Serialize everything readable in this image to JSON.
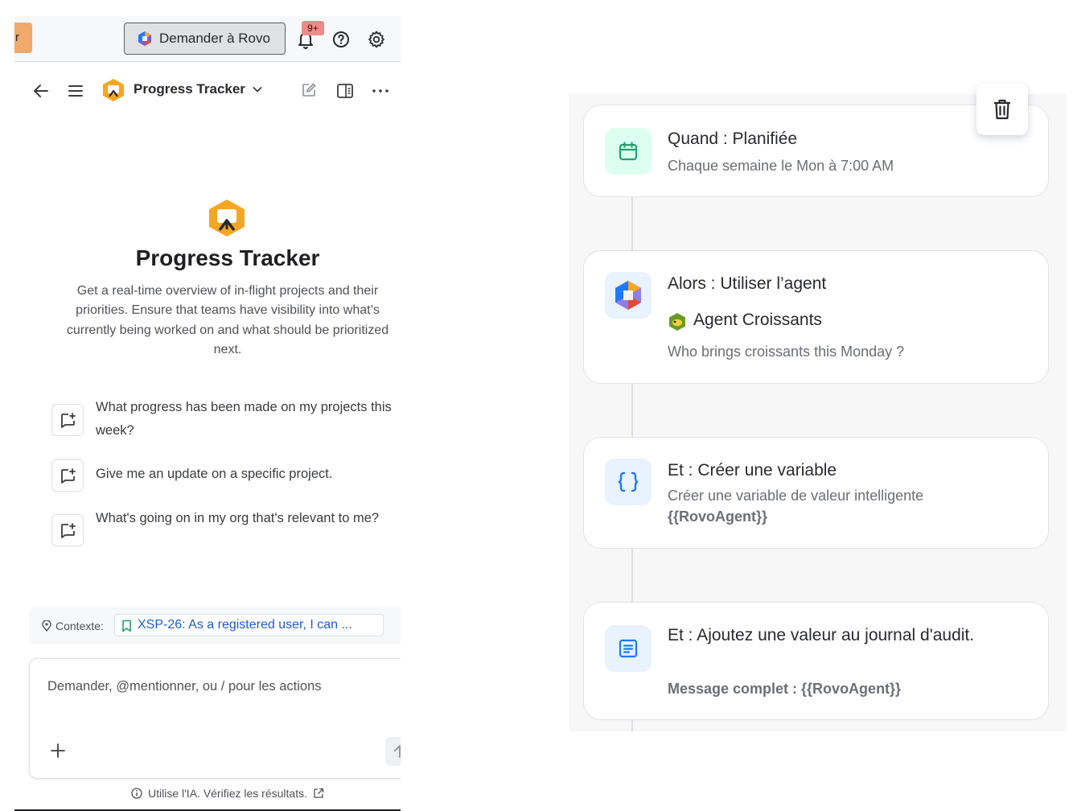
{
  "topbar": {
    "cut_text": "r",
    "ask_rovo_label": "Demander à Rovo",
    "notification_badge": "9+"
  },
  "navbar": {
    "agent_name": "Progress Tracker"
  },
  "hero": {
    "title": "Progress Tracker",
    "description": "Get a real-time overview of in-flight projects and their priorities. Ensure that teams have visibility into what’s currently being worked on and what should be prioritized next."
  },
  "suggestions": [
    "What progress has been made on my projects this week?",
    "Give me an update on a specific project.",
    "What's going on in my org that's relevant to me?"
  ],
  "context": {
    "label": "Contexte:",
    "chip": "XSP-26: As a registered user, I can ...",
    "chevron": "›"
  },
  "composer": {
    "placeholder": "Demander, @mentionner, ou / pour les actions"
  },
  "disclaimer": "Utilise l'IA. Vérifiez les résultats.",
  "workflow": {
    "trigger": {
      "title": "Quand : Planifiée",
      "subtitle": "Chaque semaine le Mon à 7:00 AM"
    },
    "action_agent": {
      "title": "Alors : Utiliser l’agent",
      "agent_name": "Agent Croissants",
      "prompt": "Who brings croissants this Monday ?"
    },
    "action_variable": {
      "title": "Et : Créer une variable",
      "subtitle": "Créer une variable de valeur intelligente",
      "variable": "{{RovoAgent}}"
    },
    "action_audit": {
      "title": "Et : Ajoutez une valeur au journal d'audit.",
      "subtitle": "Message complet : {{RovoAgent}}"
    }
  },
  "colors": {
    "trigger_icon_bg": "#dcfff1",
    "trigger_icon_fg": "#22a06b",
    "agent_icon_bg": "#e9f2ff",
    "variable_icon_bg": "#e9f2ff",
    "variable_icon_fg": "#1d7afc",
    "audit_icon_bg": "#e9f2ff",
    "audit_icon_fg": "#1d7afc",
    "link_blue": "#1d5bd6"
  }
}
